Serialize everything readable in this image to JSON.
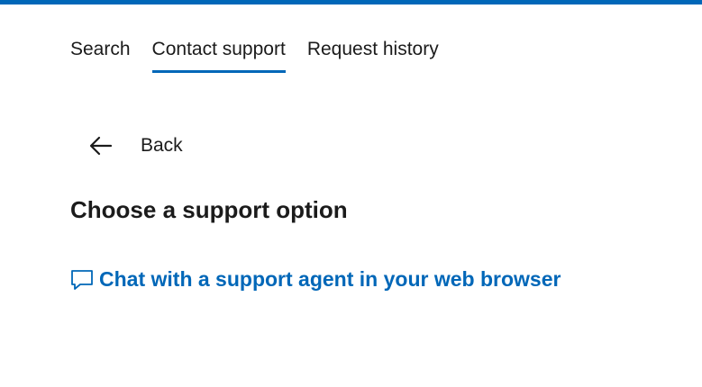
{
  "colors": {
    "accent": "#0067b8",
    "text": "#1b1b1b",
    "background": "#ffffff"
  },
  "tabs": [
    {
      "label": "Search"
    },
    {
      "label": "Contact support",
      "active": true
    },
    {
      "label": "Request history"
    }
  ],
  "back": {
    "label": "Back",
    "icon": "arrow-left-icon"
  },
  "main": {
    "heading": "Choose a support option",
    "chat_option": {
      "label": "Chat with a support agent in your web browser",
      "icon": "chat-bubble-icon"
    }
  }
}
